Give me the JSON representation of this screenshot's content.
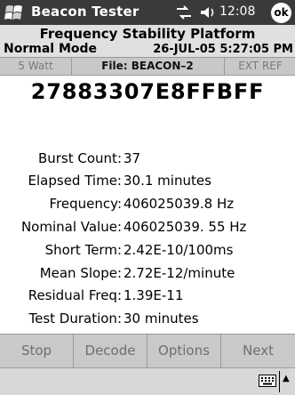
{
  "titlebar": {
    "app_title": "Beacon Tester",
    "time": "12:08",
    "ok_label": "ok",
    "start_icon": "windows-flag-icon",
    "connectivity_icon": "connectivity-icon",
    "volume_icon": "speaker-icon"
  },
  "header": {
    "platform": "Frequency Stability Platform",
    "mode": "Normal Mode",
    "datetime": "26-JUL-05 5:27:05 PM"
  },
  "infobar": {
    "watt": "5 Watt",
    "file": "File: BEACON–2",
    "ext_ref": "EXT REF"
  },
  "beacon_id": "27883307E8FFBFF",
  "readings": [
    {
      "label": "Burst Count:",
      "value": "37"
    },
    {
      "label": "Elapsed Time:",
      "value": "30.1 minutes"
    },
    {
      "label": "Frequency:",
      "value": "406025039.8 Hz"
    },
    {
      "label": "Nominal Value:",
      "value": "406025039.  55 Hz"
    },
    {
      "label": "Short Term:",
      "value": "2.42E-10/100ms"
    },
    {
      "label": "Mean Slope:",
      "value": "2.72E-12/minute"
    },
    {
      "label": "Residual Freq:",
      "value": "1.39E-11"
    },
    {
      "label": "Test Duration:",
      "value": "30 minutes"
    }
  ],
  "buttons": {
    "stop": "Stop",
    "decode": "Decode",
    "options": "Options",
    "next": "Next"
  },
  "statusbar": {
    "keyboard_icon": "keyboard-icon",
    "arrow_icon": "caret-up-icon"
  },
  "colors": {
    "titlebar_bg": "#3a3a3a",
    "header_bg": "#e0e0e0",
    "infobar_bg": "#c8c8c8",
    "buttonbar_bg": "#c9c9c9",
    "disabled_text": "#7a7a7a"
  }
}
